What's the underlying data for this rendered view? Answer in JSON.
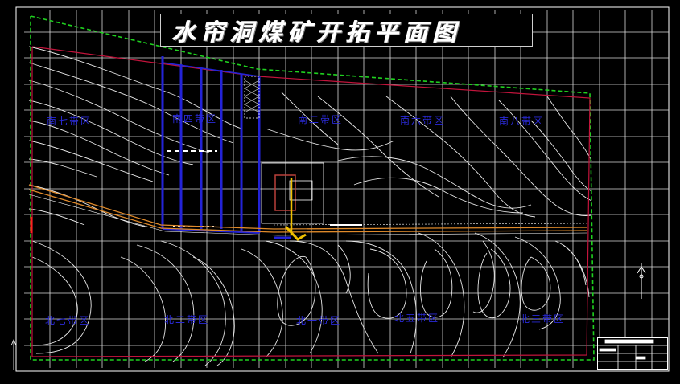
{
  "title": "水帘洞煤矿开拓平面图",
  "zones": {
    "south_7": "南七带区",
    "south_4": "南四带区",
    "south_2": "南二带区",
    "south_6": "南六带区",
    "south_8": "南八带区",
    "north_7": "北七带区",
    "north_2": "北二带区",
    "north_1": "北一带区",
    "north_5": "北五带区",
    "north_3": "北三带区"
  },
  "colors": {
    "background": "#000000",
    "grid": "#d8d8d8",
    "contour": "#e8e8e8",
    "boundary_green": "#1fd11f",
    "boundary_red": "#c3143c",
    "workings_blue": "#2323d8",
    "roadway_orange": "#e08a2a",
    "shaft_yellow": "#f0c000",
    "zone_label": "#2a2ad8"
  }
}
